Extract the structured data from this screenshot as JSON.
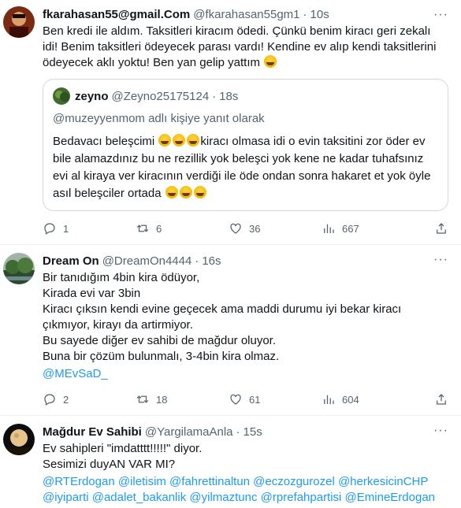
{
  "tweets": [
    {
      "name": "fkarahasan55@gmail.Com",
      "handle": "@fkarahasan55gm1",
      "time": "10s",
      "text": "Ben kredi ile aldım.  Taksitleri kiracım ödedi. Çünkü benim kiracı geri zekalı idi! Benim taksitleri ödeyecek parası vardı! Kendine ev alıp kendi taksitlerini ödeyecek aklı yoktu! Ben yan gelip yattım",
      "quote": {
        "name": "zeyno",
        "handle": "@Zeyno25175124",
        "time": "18s",
        "reply": "@muzeyyenmom adlı kişiye yanıt olarak",
        "text_a": "Bedavacı beleşcimi ",
        "text_b": "kiracı olmasa idi o evin taksitini zor öder ev bile alamazdınız bu ne rezillik yok beleşci yok kene ne kadar tuhafsınız evi al kiraya ver kiracının verdiği ile öde ondan sonra hakaret et yok öyle asıl beleşciler ortada "
      },
      "replies": "1",
      "reposts": "6",
      "likes": "36",
      "views": "667"
    },
    {
      "name": "Dream On",
      "handle": "@DreamOn4444",
      "time": "16s",
      "text": "Bir tanıdığım 4bin kira ödüyor,\nKirada evi var 3bin\nKiracı çıksın kendi evine geçecek ama maddi durumu iyi bekar kiracı çıkmıyor, kirayı da artirmiyor.\nBu sayede diğer ev sahibi de mağdur oluyor.\nBuna bir çözüm bulunmalı, 3-4bin kira olmaz.",
      "tag": "@MEvSaD_",
      "replies": "2",
      "reposts": "18",
      "likes": "61",
      "views": "604"
    },
    {
      "name": "Mağdur Ev Sahibi",
      "handle": "@YargilamaAnla",
      "time": "15s",
      "text": "Ev sahipleri \"imdatttt!!!!!\" diyor.\nSesimizi duyAN VAR MI?",
      "mentions": "@RTErdogan @iletisim @fahrettinaltun @eczozgurozel @herkesicinCHP @iyiparti @adalet_bakanlik @yilmaztunc @rprefahpartisi @EmineErdogan"
    }
  ],
  "icons": [
    "reply-icon",
    "repost-icon",
    "like-icon",
    "views-icon",
    "share-icon",
    "more-icon"
  ],
  "colors": {
    "link": "#1d9bf0",
    "secondary": "#536471",
    "border": "#cfd9de"
  }
}
